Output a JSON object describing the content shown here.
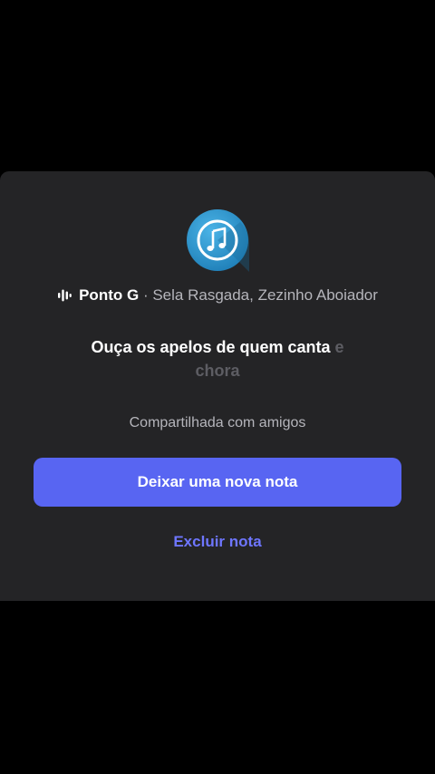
{
  "note": {
    "icon": "music-note-icon",
    "song": {
      "title": "Ponto G",
      "separator": "·",
      "artists": "Sela Rasgada, Zezinho Aboiador"
    },
    "lyric": {
      "line1_main": "Ouça os apelos de quem canta",
      "line1_faded": "e",
      "line2": "chora"
    },
    "shared_label": "Compartilhada com amigos",
    "primary_button": "Deixar uma nova nota",
    "secondary_link": "Excluir nota"
  },
  "colors": {
    "background": "#000000",
    "sheet": "#242426",
    "accent": "#5865f2",
    "link": "#6e76ff"
  }
}
